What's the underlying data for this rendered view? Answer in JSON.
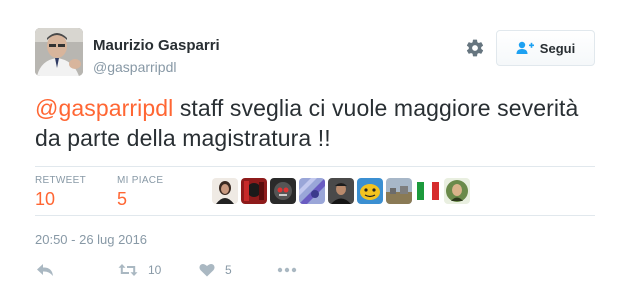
{
  "author": {
    "name": "Maurizio Gasparri",
    "handle": "@gasparripdl"
  },
  "header": {
    "settings_icon": "gear-icon",
    "follow_label": "Segui",
    "follow_icon": "add-user-icon"
  },
  "tweet": {
    "mention": "@gasparripdl",
    "text": " staff sveglia ci vuole maggiore severità da parte della magistratura !!"
  },
  "stats": {
    "retweet_label": "RETWEET",
    "retweet_count": "10",
    "likes_label": "MI PIACE",
    "likes_count": "5"
  },
  "timestamp": "20:50 - 26 lug 2016",
  "actions": {
    "reply_icon": "reply-icon",
    "retweet_icon": "retweet-icon",
    "retweet_count": "10",
    "like_icon": "heart-icon",
    "like_count": "5",
    "more_icon": "more-icon"
  },
  "colors": {
    "link": "#ff6633",
    "muted": "#8899a6",
    "text": "#292f33",
    "border": "#e1e8ed"
  }
}
